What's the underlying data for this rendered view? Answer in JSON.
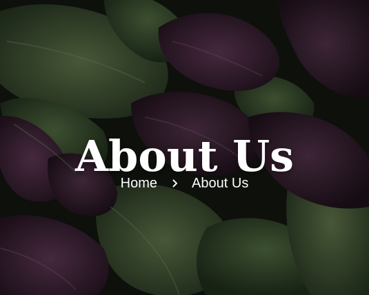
{
  "hero": {
    "title": "About Us",
    "background_icon": "basil-leaves-photo"
  },
  "breadcrumb": {
    "items": [
      {
        "label": "Home"
      },
      {
        "label": "About Us"
      }
    ],
    "separator_icon": "chevron-right-icon"
  },
  "colors": {
    "text": "#ffffff",
    "overlay": "#000000",
    "leaf_green": "#3f5a34",
    "leaf_purple": "#3d2437"
  }
}
